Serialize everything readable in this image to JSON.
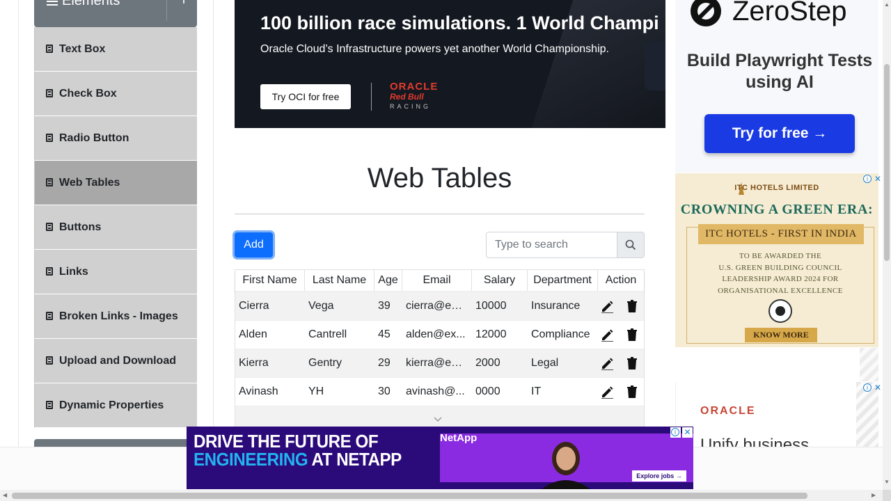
{
  "sidebar": {
    "group_title": "Elements",
    "items": [
      {
        "label": "Text Box"
      },
      {
        "label": "Check Box"
      },
      {
        "label": "Radio Button"
      },
      {
        "label": "Web Tables"
      },
      {
        "label": "Buttons"
      },
      {
        "label": "Links"
      },
      {
        "label": "Broken Links - Images"
      },
      {
        "label": "Upload and Download"
      },
      {
        "label": "Dynamic Properties"
      }
    ],
    "active_item": "Web Tables"
  },
  "top_ad": {
    "headline": "100 billion race simulations. 1 World Champi",
    "subtext": "Oracle Cloud’s Infrastructure powers yet another World Championship.",
    "cta": "Try OCI for free",
    "brand_line1": "ORACLE",
    "brand_line2": "Red Bull",
    "brand_line3": "RACING"
  },
  "main": {
    "title": "Web Tables",
    "add_label": "Add",
    "search_placeholder": "Type to search"
  },
  "table": {
    "headers": [
      "First Name",
      "Last Name",
      "Age",
      "Email",
      "Salary",
      "Department",
      "Action"
    ],
    "rows": [
      {
        "first": "Cierra",
        "last": "Vega",
        "age": "39",
        "email": "cierra@ex...",
        "salary": "10000",
        "department": "Insurance"
      },
      {
        "first": "Alden",
        "last": "Cantrell",
        "age": "45",
        "email": "alden@ex...",
        "salary": "12000",
        "department": "Compliance"
      },
      {
        "first": "Kierra",
        "last": "Gentry",
        "age": "29",
        "email": "kierra@ex...",
        "salary": "2000",
        "department": "Legal"
      },
      {
        "first": "Avinash",
        "last": "YH",
        "age": "30",
        "email": "avinash@...",
        "salary": "0000",
        "department": "IT"
      }
    ]
  },
  "right_ads": {
    "zerostep_brand": "ZeroStep",
    "zerostep_text": "Build Playwright Tests using AI",
    "zerostep_cta": "Try for free →",
    "itc_top": "ITC HOTELS LIMITED",
    "itc_headline": "CROWNING A GREEN ERA:",
    "itc_band": "ITC HOTELS - FIRST IN INDIA",
    "itc_line1": "TO BE AWARDED THE",
    "itc_line2": "U.S. GREEN BUILDING COUNCIL",
    "itc_line3": "LEADERSHIP AWARD 2024 FOR",
    "itc_line4": "ORGANISATIONAL EXCELLENCE",
    "itc_cta": "KNOW MORE",
    "oracle_logo": "ORACLE",
    "oracle_text": "Unify business"
  },
  "bottom_ad": {
    "line1": "DRIVE THE FUTURE OF",
    "line2_highlight": "ENGINEERING",
    "line2_rest": " AT NETAPP",
    "brand": "NetApp",
    "cta": "Explore jobs →"
  },
  "colors": {
    "accent": "#0d6efd",
    "sidebar_header": "#6d757d",
    "menu_item": "#d0d0d0",
    "menu_item_active": "#a8a8a8"
  }
}
